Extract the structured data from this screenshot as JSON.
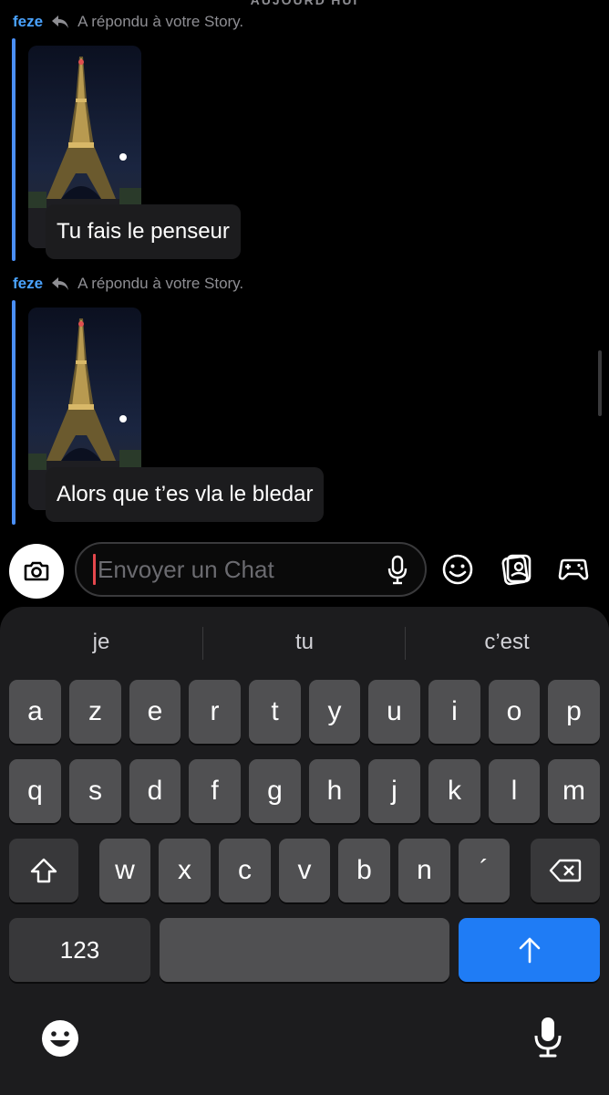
{
  "chat": {
    "day_label": "AUJOURD'HUI",
    "messages": [
      {
        "sender": "feze",
        "reply_label": "A répondu à votre Story.",
        "text": "Tu fais le penseur",
        "story_icon": "eiffel-tower-night-photo"
      },
      {
        "sender": "feze",
        "reply_label": "A répondu à votre Story.",
        "text": "Alors que t’es vla le bledar",
        "story_icon": "eiffel-tower-night-photo"
      }
    ]
  },
  "compose": {
    "placeholder": "Envoyer un Chat",
    "icons": [
      "camera-icon",
      "microphone-icon",
      "smiley-icon",
      "stickers-icon",
      "gamepad-icon"
    ]
  },
  "keyboard": {
    "suggestions": [
      "je",
      "tu",
      "c’est"
    ],
    "row1": [
      "a",
      "z",
      "e",
      "r",
      "t",
      "y",
      "u",
      "i",
      "o",
      "p"
    ],
    "row2": [
      "q",
      "s",
      "d",
      "f",
      "g",
      "h",
      "j",
      "k",
      "l",
      "m"
    ],
    "row3": [
      "w",
      "x",
      "c",
      "v",
      "b",
      "n",
      "´"
    ],
    "numbers_label": "123",
    "icons": [
      "shift-icon",
      "backspace-icon",
      "send-arrow-icon",
      "emoji-keyboard-icon",
      "dictation-mic-icon"
    ]
  },
  "colors": {
    "sender": "#4aa3ff",
    "reply_bar": "#4a8ff7",
    "send_key": "#1f7cf5",
    "caret": "#e5484d"
  }
}
